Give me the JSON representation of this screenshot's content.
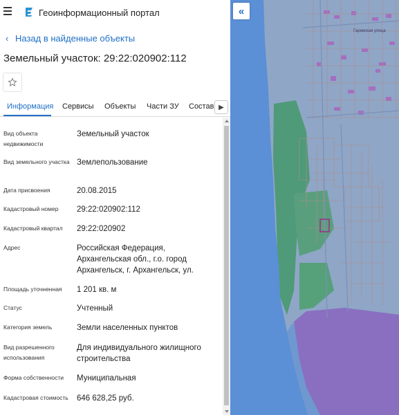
{
  "header": {
    "portal_title": "Геоинформационный портал",
    "menu_icon": "hamburger-menu-icon",
    "logo_icon": "portal-logo-icon"
  },
  "nav": {
    "back_label": "Назад в найденные объекты"
  },
  "parcel": {
    "title": "Земельный участок: 29:22:020902:112"
  },
  "tabs": [
    {
      "label": "Информация",
      "active": true
    },
    {
      "label": "Сервисы",
      "active": false
    },
    {
      "label": "Объекты",
      "active": false
    },
    {
      "label": "Части ЗУ",
      "active": false
    },
    {
      "label": "Состав",
      "active": false
    }
  ],
  "info_rows": [
    {
      "label": "Вид объекта недвижимости",
      "value": "Земельный участок"
    },
    {
      "label": "Вид земельного участка",
      "value": "Землепользование"
    },
    {
      "label": "Дата присвоения",
      "value": "20.08.2015"
    },
    {
      "label": "Кадастровый номер",
      "value": "29:22:020902:112"
    },
    {
      "label": "Кадастровый квартал",
      "value": "29:22:020902"
    },
    {
      "label": "Адрес",
      "value": "Российская Федерация, Архангельская обл., г.о. город Архангельск, г. Архангельск, ул."
    },
    {
      "label": "Площадь уточненная",
      "value": "1 201 кв. м"
    },
    {
      "label": "Статус",
      "value": "Учтенный"
    },
    {
      "label": "Категория земель",
      "value": "Земли населенных пунктов"
    },
    {
      "label": "Вид разрешенного использования",
      "value": "Для индивидуального жилищного строительства"
    },
    {
      "label": "Форма собственности",
      "value": "Муниципальная"
    },
    {
      "label": "Кадастровая стоимость",
      "value": "646 628,25 руб."
    }
  ],
  "map": {
    "street_label": "Гаревская улица",
    "colors": {
      "water": "#5b8fd6",
      "land": "#8fa6c6",
      "forest": "#4f9a78",
      "district": "#8a6fc1",
      "building": "#a46fc0",
      "parcel_line": "#b08a8a",
      "selected_parcel": "#9b2c8c"
    }
  }
}
